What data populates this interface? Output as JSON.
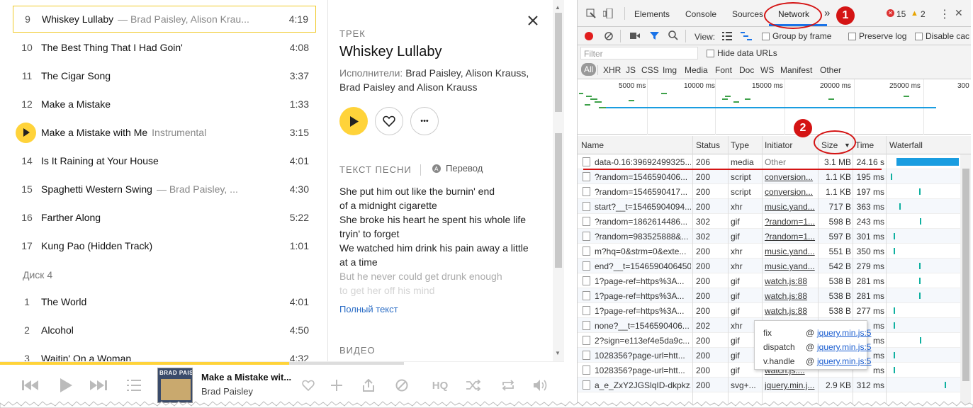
{
  "tracklist": {
    "tracks": [
      {
        "num": "9",
        "title": "Whiskey Lullaby",
        "sub": "— Brad Paisley, Alison Krau...",
        "dur": "4:19"
      },
      {
        "num": "10",
        "title": "The Best Thing That I Had Goin'",
        "sub": "",
        "dur": "4:08"
      },
      {
        "num": "11",
        "title": "The Cigar Song",
        "sub": "",
        "dur": "3:37"
      },
      {
        "num": "12",
        "title": "Make a Mistake",
        "sub": "",
        "dur": "1:33"
      },
      {
        "num": "",
        "title": "Make a Mistake with Me",
        "sub": "Instrumental",
        "dur": "3:15"
      },
      {
        "num": "14",
        "title": "Is It Raining at Your House",
        "sub": "",
        "dur": "4:01"
      },
      {
        "num": "15",
        "title": "Spaghetti Western Swing",
        "sub": "— Brad Paisley, ...",
        "dur": "4:30"
      },
      {
        "num": "16",
        "title": "Farther Along",
        "sub": "",
        "dur": "5:22"
      },
      {
        "num": "17",
        "title": "Kung Pao (Hidden Track)",
        "sub": "",
        "dur": "1:01"
      }
    ],
    "disc_label": "Диск 4",
    "disc_tracks": [
      {
        "num": "1",
        "title": "The World",
        "sub": "",
        "dur": "4:01"
      },
      {
        "num": "2",
        "title": "Alcohol",
        "sub": "",
        "dur": "4:50"
      },
      {
        "num": "3",
        "title": "Waitin' On a Woman",
        "sub": "",
        "dur": "4:32"
      }
    ]
  },
  "panel": {
    "label": "ТРЕК",
    "title": "Whiskey Lullaby",
    "artists_prefix": "Исполнители:",
    "artists": "Brad Paisley, Alison Krauss, Brad Paisley and Alison Krauss",
    "lyrics_label": "ТЕКСТ ПЕСНИ",
    "translate_label": "Перевод",
    "lyrics": [
      "She put him out like the burnin' end",
      "of a midnight cigarette",
      "She broke his heart he spent his whole life",
      "tryin' to forget",
      "We watched him drink his pain away a little",
      "at a time"
    ],
    "lyrics_fade1": "But he never could get drunk enough",
    "lyrics_fade2": "to get her off his mind",
    "full_text": "Полный текст",
    "video_label": "ВИДЕО",
    "close_glyph": "✕",
    "more_glyph": "•••"
  },
  "player": {
    "progress": 0.716,
    "now_title": "Make a Mistake wit...",
    "now_artist": "Brad Paisley",
    "cover_text": "BRAD PAISLEY",
    "hq_label": "HQ"
  },
  "devtools": {
    "tabs": [
      "Elements",
      "Console",
      "Sources",
      "Network"
    ],
    "more_tabs": "»",
    "errors": "15",
    "warnings": "2",
    "view_label": "View:",
    "group_by_frame": "Group by frame",
    "preserve_log": "Preserve log",
    "disable_cache": "Disable cac",
    "filter_placeholder": "Filter",
    "hide_data_urls": "Hide data URLs",
    "types": [
      "All",
      "XHR",
      "JS",
      "CSS",
      "Img",
      "Media",
      "Font",
      "Doc",
      "WS",
      "Manifest",
      "Other"
    ],
    "overview_ticks": [
      "5000 ms",
      "10000 ms",
      "15000 ms",
      "20000 ms",
      "25000 ms",
      "300"
    ],
    "columns": [
      "Name",
      "Status",
      "Type",
      "Initiator",
      "Size",
      "Time",
      "Waterfall"
    ],
    "size_sort": "▼",
    "rows": [
      {
        "name": "data-0.16:39692499325...",
        "status": "206",
        "type": "media",
        "init": "Other",
        "size": "3.1 MB",
        "time": "24.16 s"
      },
      {
        "name": "?random=1546590406...",
        "status": "200",
        "type": "script",
        "init": "conversion...",
        "size": "1.1 KB",
        "time": "195 ms"
      },
      {
        "name": "?random=1546590417...",
        "status": "200",
        "type": "script",
        "init": "conversion...",
        "size": "1.1 KB",
        "time": "197 ms"
      },
      {
        "name": "start?__t=15465904094...",
        "status": "200",
        "type": "xhr",
        "init": "music.yand...",
        "size": "717 B",
        "time": "363 ms"
      },
      {
        "name": "?random=1862614486...",
        "status": "302",
        "type": "gif",
        "init": "?random=1...",
        "size": "598 B",
        "time": "243 ms"
      },
      {
        "name": "?random=983525888&...",
        "status": "302",
        "type": "gif",
        "init": "?random=1...",
        "size": "597 B",
        "time": "301 ms"
      },
      {
        "name": "m?hq=0&strm=0&exte...",
        "status": "200",
        "type": "xhr",
        "init": "music.yand...",
        "size": "551 B",
        "time": "350 ms"
      },
      {
        "name": "end?__t=1546590406450",
        "status": "200",
        "type": "xhr",
        "init": "music.yand...",
        "size": "542 B",
        "time": "279 ms"
      },
      {
        "name": "1?page-ref=https%3A...",
        "status": "200",
        "type": "gif",
        "init": "watch.js:88",
        "size": "538 B",
        "time": "281 ms"
      },
      {
        "name": "1?page-ref=https%3A...",
        "status": "200",
        "type": "gif",
        "init": "watch.js:88",
        "size": "538 B",
        "time": "281 ms"
      },
      {
        "name": "1?page-ref=https%3A...",
        "status": "200",
        "type": "gif",
        "init": "watch.js:88",
        "size": "538 B",
        "time": "277 ms"
      },
      {
        "name": "none?__t=1546590406...",
        "status": "202",
        "type": "xhr",
        "init": "",
        "size": "",
        "time": "ms"
      },
      {
        "name": "2?sign=e113ef4e5da9c...",
        "status": "200",
        "type": "gif",
        "init": "",
        "size": "",
        "time": "ms"
      },
      {
        "name": "1028356?page-url=htt...",
        "status": "200",
        "type": "gif",
        "init": "",
        "size": "",
        "time": "ms"
      },
      {
        "name": "1028356?page-url=htt...",
        "status": "200",
        "type": "gif",
        "init": "watch.js:...",
        "size": "",
        "time": "ms"
      },
      {
        "name": "a_e_ZxY2JGSlqID-dkpkz...",
        "status": "200",
        "type": "svg+...",
        "init": "jquery.min.j...",
        "size": "2.9 KB",
        "time": "312 ms"
      }
    ],
    "tooltip": [
      {
        "fn": "fix",
        "at": "@",
        "link": "jquery.min.js:5"
      },
      {
        "fn": "dispatch",
        "at": "@",
        "link": "jquery.min.js:5"
      },
      {
        "fn": "v.handle",
        "at": "@",
        "link": "jquery.min.js:5"
      }
    ]
  },
  "annotations": {
    "badge1": "1",
    "badge2": "2"
  },
  "colors": {
    "accent": "#ffd33a",
    "annotation": "#d41414",
    "link": "#1a5dd0",
    "record": "#e11d1d",
    "waterfall_bar": "#0fb0a0"
  }
}
